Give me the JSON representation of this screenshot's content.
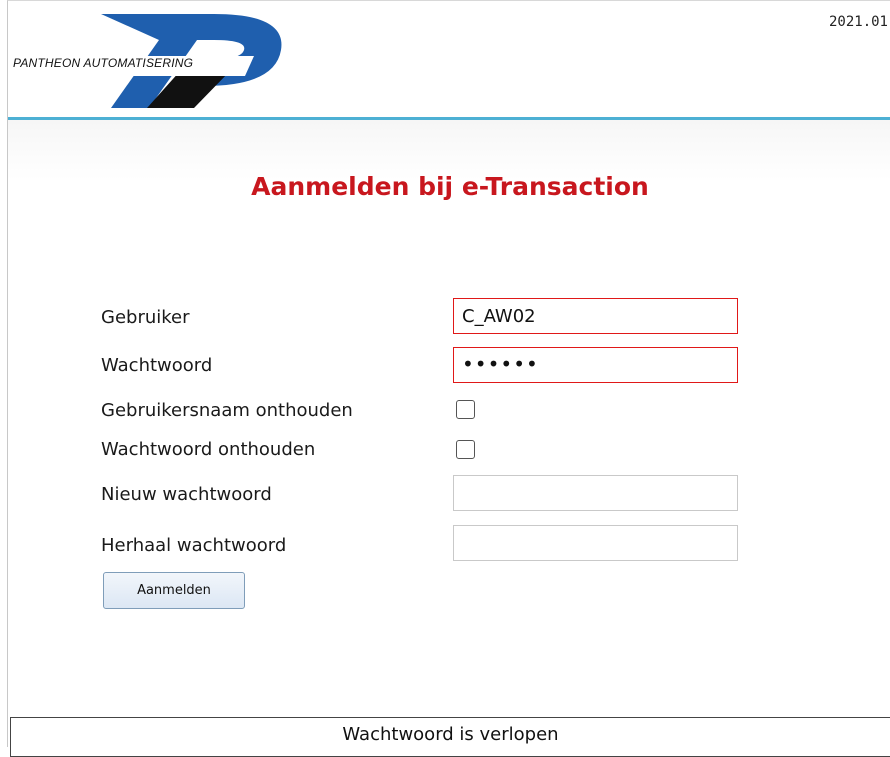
{
  "header": {
    "version": "2021.01",
    "logo_text": "PANTHEON AUTOMATISERING",
    "colors": {
      "accent_rule": "#4db0d4",
      "logo_blue": "#1f5fae"
    }
  },
  "login": {
    "title": "Aanmelden bij e-Transaction",
    "fields": {
      "user": {
        "label": "Gebruiker",
        "value": "C_AW02"
      },
      "password": {
        "label": "Wachtwoord",
        "value": "••••••"
      },
      "remember_user": {
        "label": "Gebruikersnaam onthouden",
        "checked": false
      },
      "remember_password": {
        "label": "Wachtwoord onthouden",
        "checked": false
      },
      "new_password": {
        "label": "Nieuw wachtwoord",
        "value": ""
      },
      "repeat_password": {
        "label": "Herhaal wachtwoord",
        "value": ""
      }
    },
    "submit_label": "Aanmelden",
    "colors": {
      "title": "#c8171e",
      "error_border": "#e01818"
    }
  },
  "status": {
    "message": "Wachtwoord is verlopen"
  }
}
